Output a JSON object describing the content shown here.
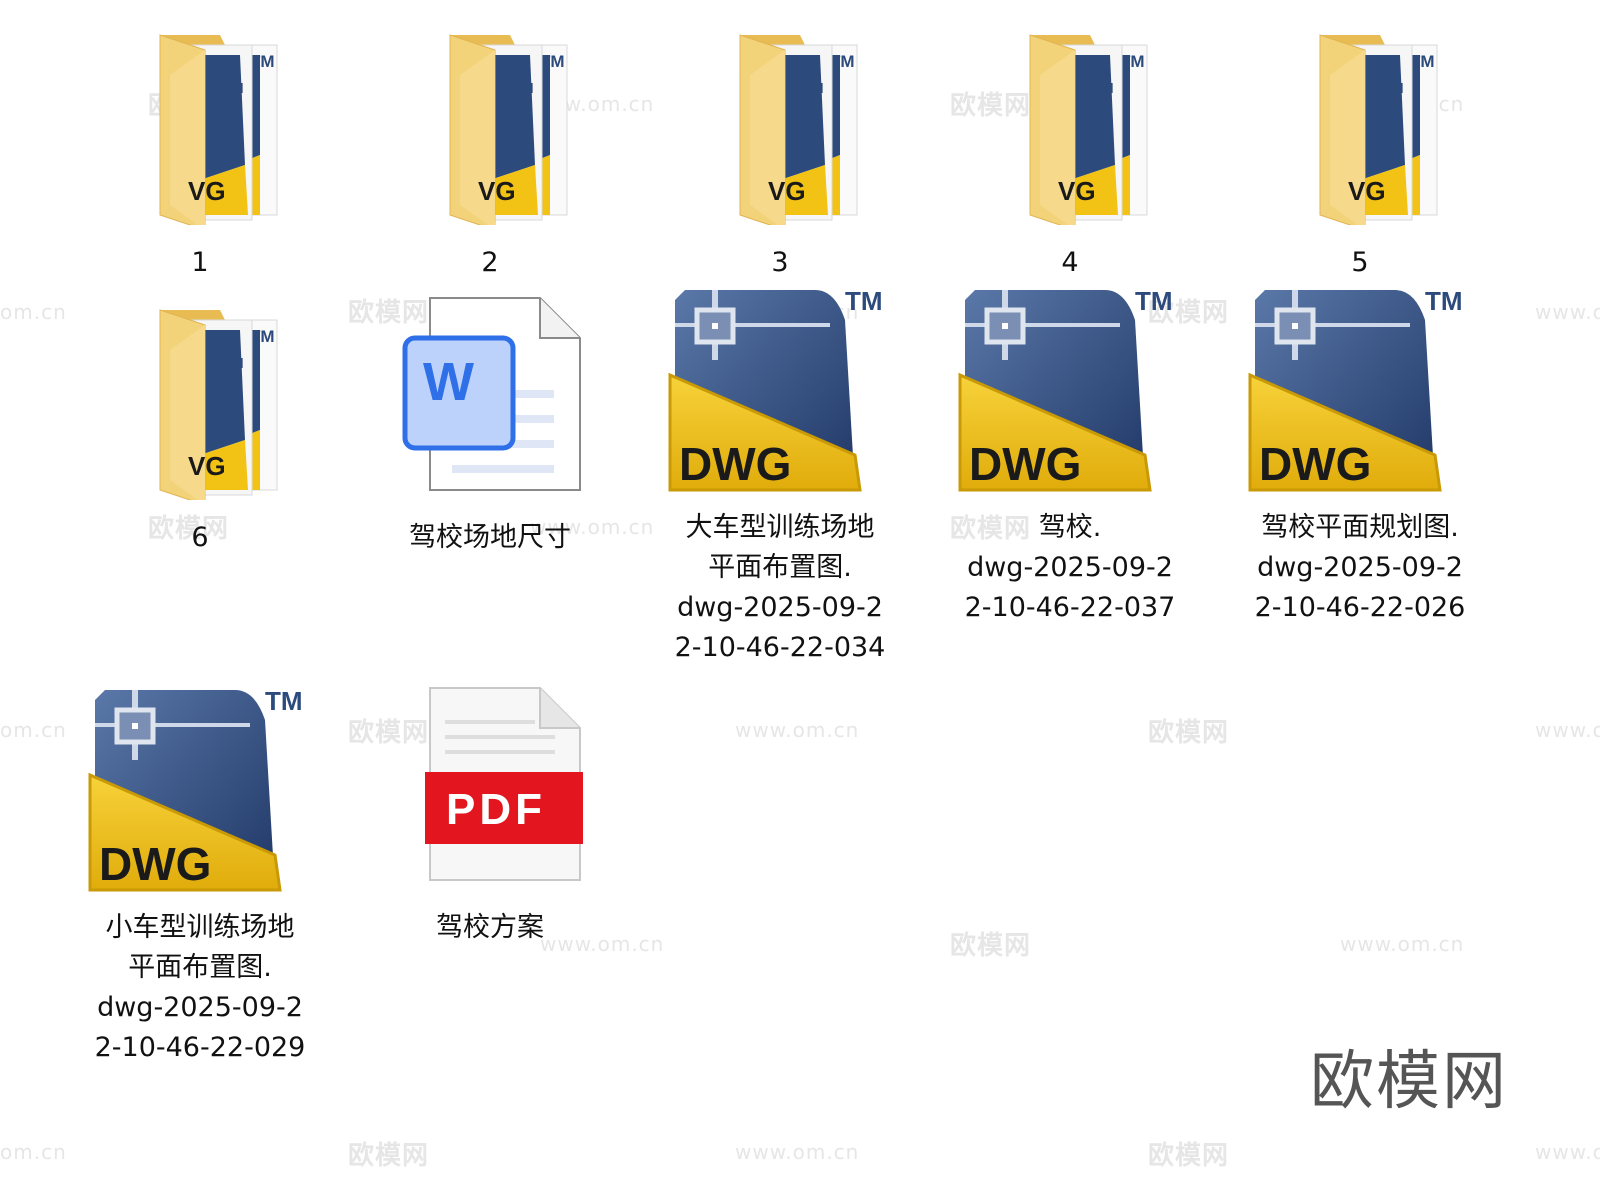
{
  "items": [
    {
      "name": "1",
      "type": "folder",
      "icon": "autocad-folder-icon"
    },
    {
      "name": "2",
      "type": "folder",
      "icon": "autocad-folder-icon"
    },
    {
      "name": "3",
      "type": "folder",
      "icon": "autocad-folder-icon"
    },
    {
      "name": "4",
      "type": "folder",
      "icon": "autocad-folder-icon"
    },
    {
      "name": "5",
      "type": "folder",
      "icon": "autocad-folder-icon"
    },
    {
      "name": "6",
      "type": "folder",
      "icon": "autocad-folder-icon"
    },
    {
      "name": "驾校场地尺寸",
      "type": "word",
      "icon": "word-document-icon",
      "badge": "W"
    },
    {
      "name": "大车型训练场地平面布置图.dwg-2025-09-22-10-46-22-034",
      "display": "大车型训练场地\n平面布置图.\ndwg-2025-09-2\n2-10-46-22-034",
      "type": "dwg",
      "icon": "dwg-file-icon",
      "badge": "DWG",
      "tm": "TM"
    },
    {
      "name": "驾校.dwg-2025-09-22-10-46-22-037",
      "display": "驾校.\ndwg-2025-09-2\n2-10-46-22-037",
      "type": "dwg",
      "icon": "dwg-file-icon",
      "badge": "DWG",
      "tm": "TM"
    },
    {
      "name": "驾校平面规划图.dwg-2025-09-22-10-46-22-026",
      "display": "驾校平面规划图.\ndwg-2025-09-2\n2-10-46-22-026",
      "type": "dwg",
      "icon": "dwg-file-icon",
      "badge": "DWG",
      "tm": "TM"
    },
    {
      "name": "小车型训练场地平面布置图.dwg-2025-09-22-10-46-22-029",
      "display": "小车型训练场地\n平面布置图.\ndwg-2025-09-2\n2-10-46-22-029",
      "type": "dwg",
      "icon": "dwg-file-icon",
      "badge": "DWG",
      "tm": "TM"
    },
    {
      "name": "驾校方案",
      "type": "pdf",
      "icon": "pdf-document-icon",
      "badge": "PDF"
    }
  ],
  "folder_badge": {
    "tm": "TM",
    "dwg": "VG"
  },
  "watermark": {
    "logo": "欧模网",
    "url": "www.om.cn",
    "url_fragment": "om.cn"
  },
  "brand": "欧模网",
  "colors": {
    "folder": "#f3d37a",
    "folder_dark": "#e8bc52",
    "dwg_blue": "#2c4a7c",
    "dwg_yellow": "#f2c314",
    "word_blue": "#2f6fe8",
    "pdf_red": "#e3161f"
  }
}
